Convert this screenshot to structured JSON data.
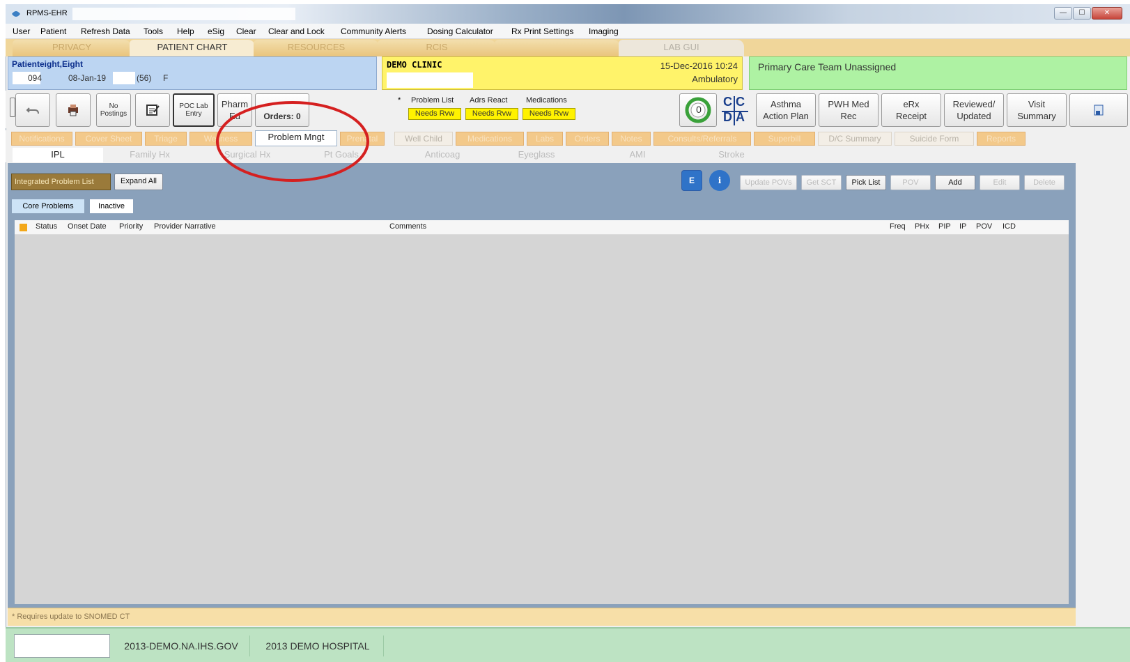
{
  "window": {
    "title": "RPMS-EHR",
    "min_glyph": "—",
    "max_glyph": "☐",
    "close_glyph": "✕"
  },
  "menu": [
    "User",
    "Patient",
    "Refresh Data",
    "Tools",
    "Help",
    "eSig",
    "Clear",
    "Clear and Lock",
    "Community Alerts",
    "Dosing Calculator",
    "Rx Print Settings",
    "Imaging"
  ],
  "top_tabs": [
    "PRIVACY",
    "PATIENT CHART",
    "RESOURCES",
    "RCIS",
    "",
    "LAB GUI"
  ],
  "patient": {
    "name": "Patienteight,Eight",
    "chart": "094",
    "dob": "08-Jan-19",
    "age": "(56)",
    "sex": "F"
  },
  "clinic": {
    "name": "DEMO CLINIC",
    "datetime": "15-Dec-2016 10:24",
    "type": "Ambulatory"
  },
  "care_team": "Primary Care Team Unassigned",
  "toolbar": {
    "no_postings": "No Postings",
    "poc_lab_entry": "POC Lab Entry",
    "pharm_ed": "Pharm Ed",
    "orders_label": "Orders: 0",
    "review_headers": [
      "Problem List",
      "Adrs React",
      "Medications"
    ],
    "review_badges": [
      "Needs Rvw",
      "Needs Rvw",
      "Needs Rvw"
    ],
    "counter": "0",
    "cdc": [
      "C",
      "C",
      "D",
      "A"
    ],
    "asthma": "Asthma Action Plan",
    "pwh": "PWH Med Rec",
    "erx": "eRx Receipt",
    "reviewed": "Reviewed/ Updated",
    "visit_summary": "Visit Summary"
  },
  "chart_tabs": [
    "Notifications",
    "Cover Sheet",
    "Triage",
    "Wellness",
    "Problem Mngt",
    "Prenatal",
    "Well Child",
    "Medications",
    "Labs",
    "Orders",
    "Notes",
    "Consults/Referrals",
    "Superbill",
    "D/C Summary",
    "Suicide Form",
    "Reports"
  ],
  "sub_tabs": [
    "IPL",
    "Family Hx",
    "Surgical Hx",
    "Pt Goals",
    "Anticoag",
    "Eyeglass",
    "AMI",
    "Stroke"
  ],
  "panel": {
    "title": "Integrated Problem List",
    "expand_all": "Expand All",
    "tabs": [
      "Core Problems",
      "Inactive"
    ],
    "buttons": [
      "Update POVs",
      "Get SCT",
      "Pick List",
      "POV",
      "Add",
      "Edit",
      "Delete"
    ],
    "columns_left": [
      "Status",
      "Onset Date",
      "Priority",
      "Provider Narrative"
    ],
    "columns_comments": "Comments",
    "columns_right": [
      "Freq",
      "PHx",
      "PIP",
      "IP",
      "POV",
      "ICD"
    ],
    "footnote": "* Requires update to SNOMED CT"
  },
  "status_bar": [
    "",
    "2013-DEMO.NA.IHS.GOV",
    "2013 DEMO HOSPITAL"
  ]
}
